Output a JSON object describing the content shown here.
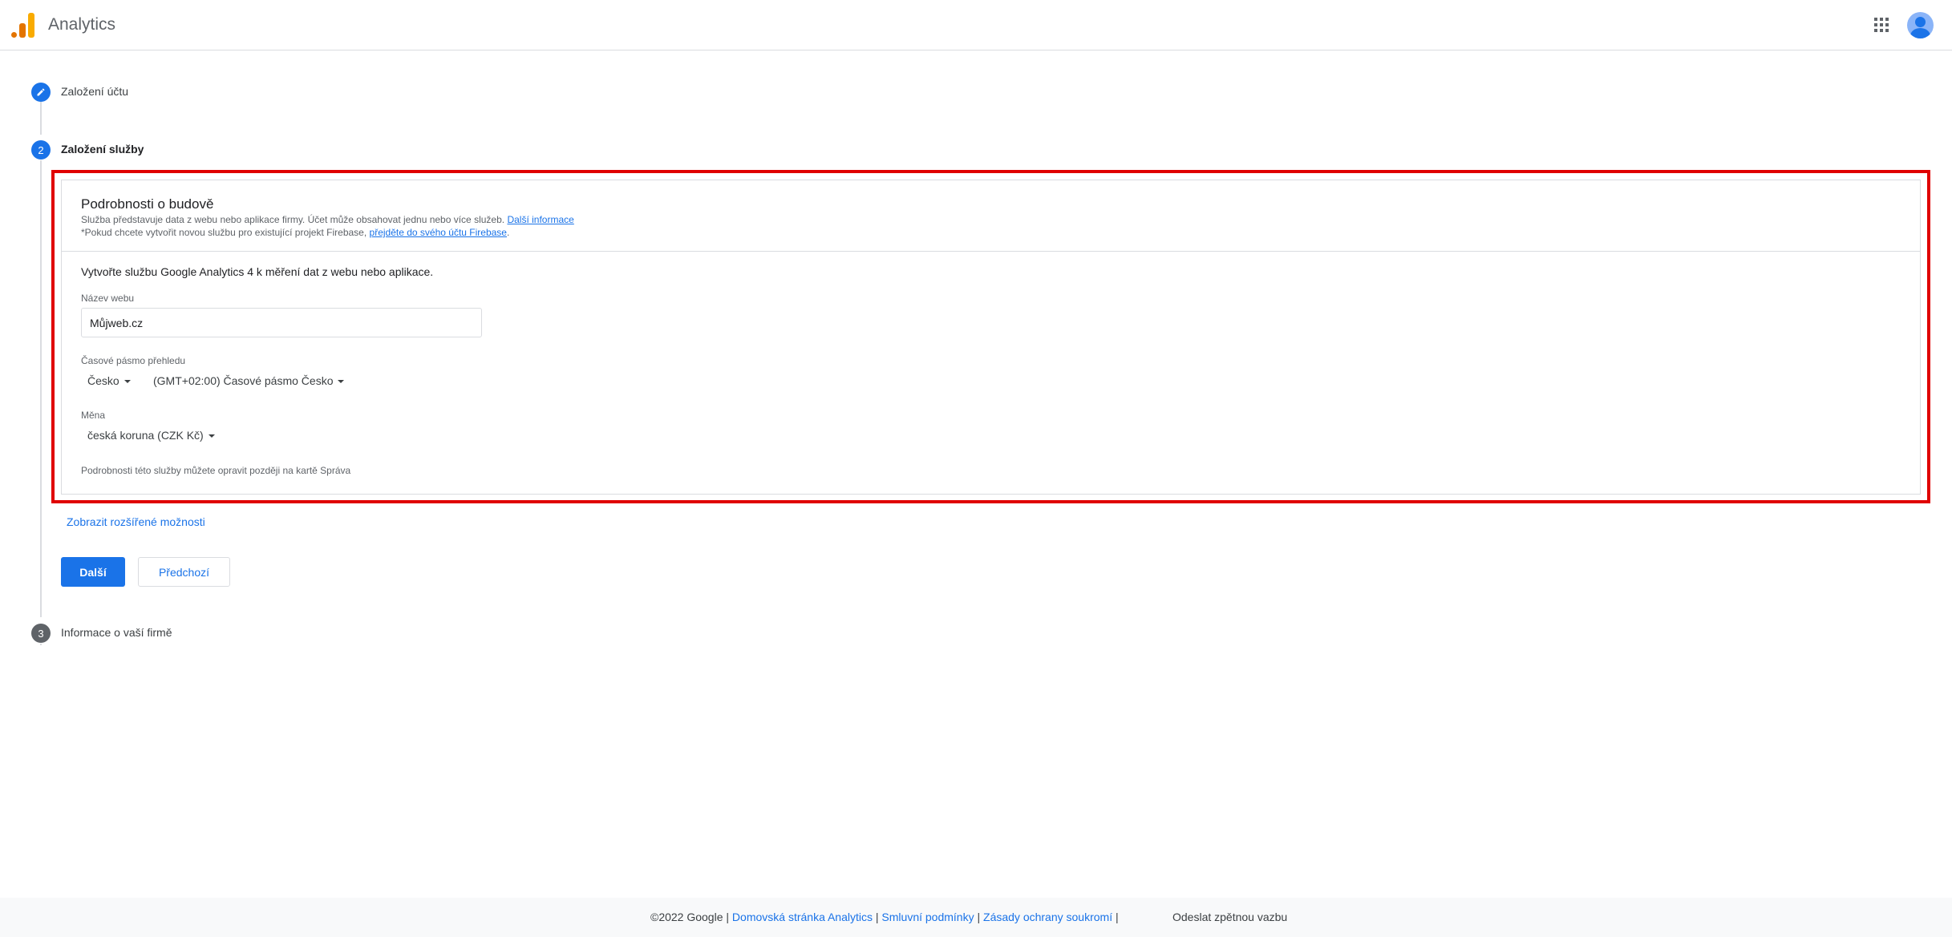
{
  "header": {
    "app_title": "Analytics",
    "logo_icon": "google-analytics-logo",
    "apps_icon": "apps-grid-icon",
    "avatar_icon": "account-avatar-icon"
  },
  "steps": [
    {
      "number": "",
      "label": "Založení účtu",
      "icon": "pencil-icon",
      "state": "completed"
    },
    {
      "number": "2",
      "label": "Založení služby",
      "state": "active"
    },
    {
      "number": "3",
      "label": "Informace o vaší firmě",
      "state": "pending"
    }
  ],
  "card": {
    "title": "Podrobnosti o budově",
    "desc_line1": "Služba představuje data z webu nebo aplikace firmy. Účet může obsahovat jednu nebo více služeb.",
    "desc_line1_link": "Další informace",
    "desc_line2": "*Pokud chcete vytvořit novou službu pro existující projekt Firebase,",
    "desc_line2_link": "přejděte do svého účtu Firebase",
    "desc_line2_end": ".",
    "intro": "Vytvořte službu Google Analytics 4 k měření dat z webu nebo aplikace.",
    "site_name_label": "Název webu",
    "site_name_value": "Můjweb.cz",
    "timezone_label": "Časové pásmo přehledu",
    "country_value": "Česko",
    "timezone_value": "(GMT+02:00) Časové pásmo Česko",
    "currency_label": "Měna",
    "currency_value": "česká koruna (CZK Kč)",
    "note": "Podrobnosti této služby můžete opravit později na kartě Správa"
  },
  "advanced_link": "Zobrazit rozšířené možnosti",
  "buttons": {
    "next": "Další",
    "previous": "Předchozí"
  },
  "footer": {
    "copyright": "©2022 Google |",
    "link_home": "Domovská stránka Analytics",
    "sep1": "|",
    "link_terms": "Smluvní podmínky",
    "sep2": "|",
    "link_privacy": "Zásady ochrany soukromí",
    "sep3": "|",
    "feedback": "Odeslat zpětnou vazbu"
  },
  "colors": {
    "accent": "#1a73e8",
    "highlight_border": "#e00000",
    "step_pending": "#5f6368"
  }
}
